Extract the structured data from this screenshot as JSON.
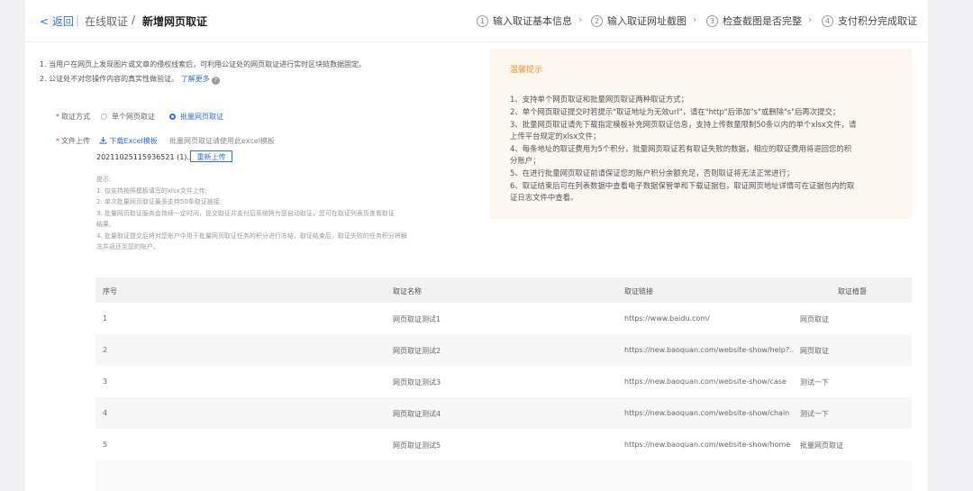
{
  "header": {
    "back": "< 返回",
    "breadcrumb": [
      "在线取证",
      "新增网页取证"
    ],
    "steps": [
      {
        "num": "1",
        "label": "输入取证基本信息"
      },
      {
        "num": "2",
        "label": "输入取证网址截图"
      },
      {
        "num": "3",
        "label": "检查截图是否完整"
      },
      {
        "num": "4",
        "label": "支付积分完成取证"
      }
    ]
  },
  "intro": {
    "line1": "1. 当用户在网页上发现图片或文章的侵权线索后，可利用公证处的网页取证进行实时区块链数据固定。",
    "line2": "2. 公证处不对您操作内容的真实性做验证。",
    "more": "了解更多",
    "help_icon": "question-icon"
  },
  "form": {
    "method_label": "取证方式",
    "options": [
      "单个网页取证",
      "批量网页取证"
    ],
    "selected": "批量网页取证",
    "upload_label": "文件上传",
    "download_template": "下载Excel模板",
    "download_icon": "download-icon",
    "template_hint": "批量网页取证请使用此excel模板",
    "file_name": "20211025115936521 (1).xlsx",
    "reupload": "重新上传",
    "tips": [
      "提示:",
      "1. 仅支持按照模板填写的xlsx文件上传;",
      "2. 单次批量网页取证最多支持50条取证链接;",
      "3. 批量网页取证服务会持续一定时间，提交取证并支付后系统将为您自动取证，您可在取证列表页查看取证",
      "结果;",
      "4. 批量取证提交后将对您账户中用于批量网页取证任务的积分进行冻结，取证结束后，取证失败的任务积分将解",
      "冻并返还至您的账户。"
    ]
  },
  "notice": {
    "title": "温馨提示",
    "lines": [
      "1、支持单个网页取证和批量网页取证两种取证方式；",
      "2、单个网页取证提交时若提示\"取证地址为无效url\"，请在\"http\"后添加\"s\"或删除\"s\"后再次提交；",
      "3、批量网页取证请先下载指定模板补充网页取证信息，支持上传数量限制50条以内的单个xlsx文件，请",
      "上传平台规定的xlsx文件；",
      "4、每条地址的取证费用为5个积分，批量网页取证若有取证失败的数据，相应的取证费用将退回您的积",
      "分账户；",
      "5、在进行批量网页取证前请保证您的账户积分余额充足，否则取证将无法正常进行；",
      "6、取证结束后可在列表数据中查看电子数据保管单和下载证据包，取证网页地址详情可在证据包内的取",
      "证日志文件中查看。"
    ]
  },
  "table": {
    "columns": [
      "序号",
      "取证名称",
      "取证链接",
      "取证植督"
    ],
    "rows": [
      {
        "no": "1",
        "name": "网页取证测试1",
        "url": "https://www.baidu.com/",
        "note": "网页取证"
      },
      {
        "no": "2",
        "name": "网页取证测试2",
        "url": "https://new.baoquan.com/website-show/help?...",
        "note": "网页取证"
      },
      {
        "no": "3",
        "name": "网页取证测试3",
        "url": "https://new.baoquan.com/website-show/case",
        "note": "测试一下"
      },
      {
        "no": "4",
        "name": "网页取证测试4",
        "url": "https://new.baoquan.com/website-show/chain",
        "note": "测试一下"
      },
      {
        "no": "5",
        "name": "网页取证测试5",
        "url": "https://new.baoquan.com/website-show/home",
        "note": "批量网页取证"
      }
    ]
  }
}
